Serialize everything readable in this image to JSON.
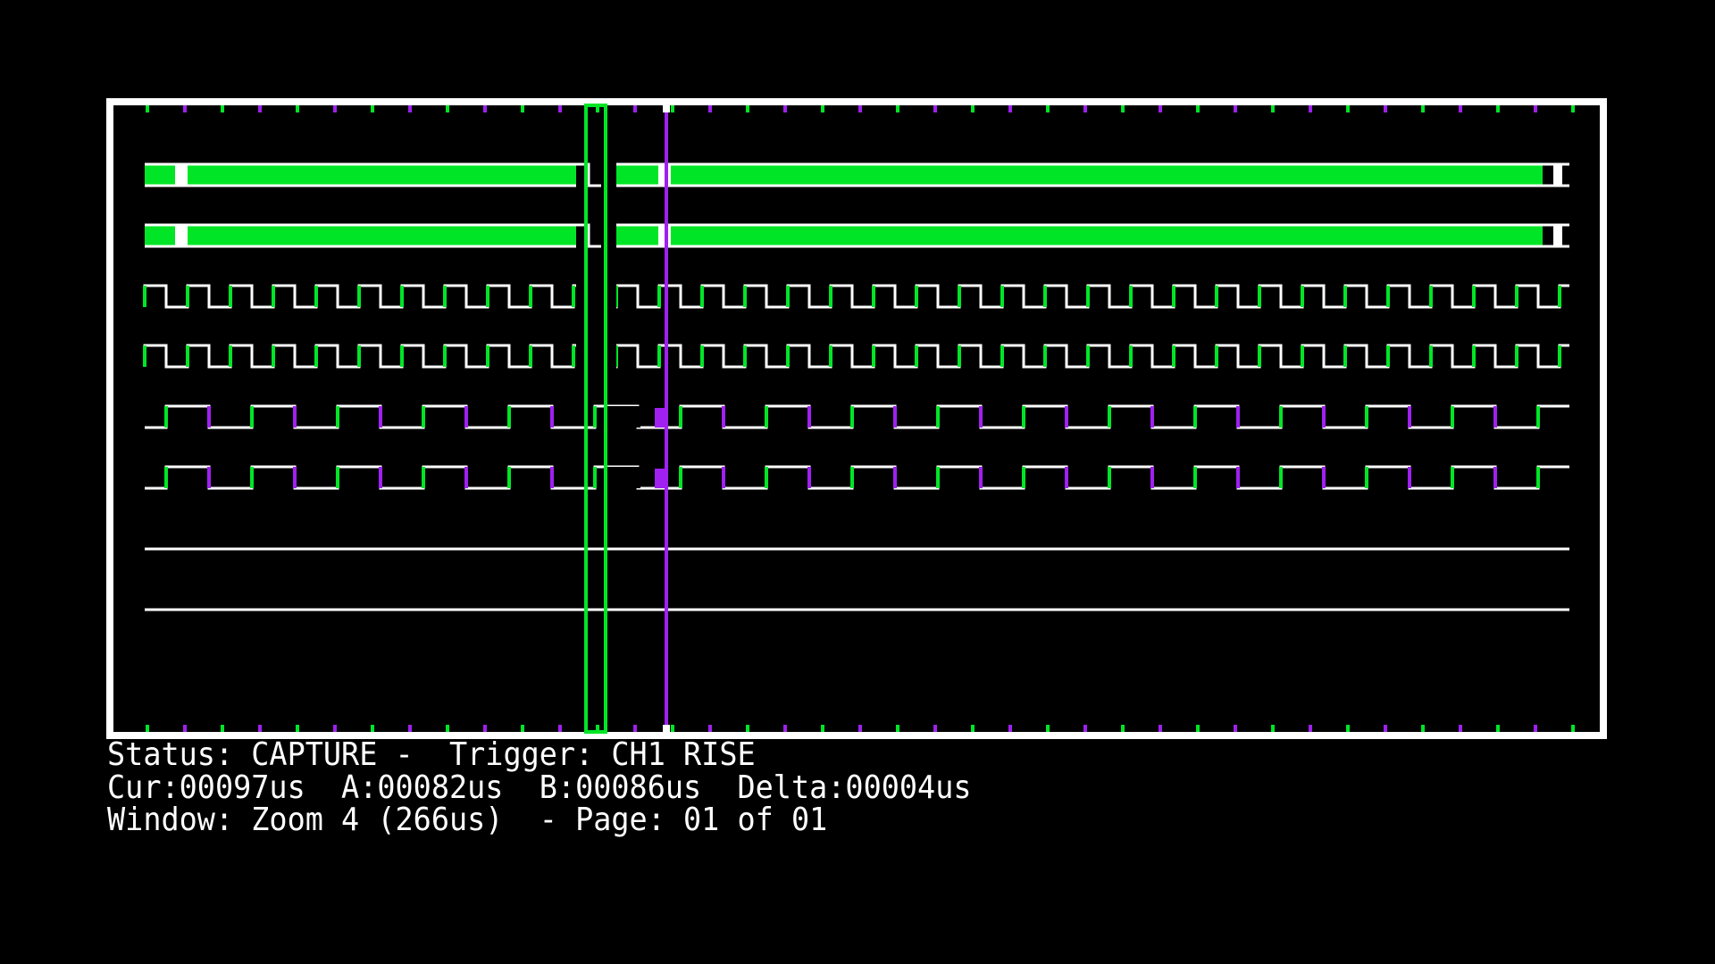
{
  "app": {
    "background_color": "#000000",
    "colors": {
      "trace_white": "#ffffff",
      "trace_green": "#00e626",
      "trace_purple": "#a020f0"
    }
  },
  "scope": {
    "channels": [
      {
        "id": "ch1",
        "kind": "bus"
      },
      {
        "id": "ch2",
        "kind": "bus"
      },
      {
        "id": "ch3",
        "kind": "clock"
      },
      {
        "id": "ch4",
        "kind": "clock"
      },
      {
        "id": "ch5",
        "kind": "slow-clock"
      },
      {
        "id": "ch6",
        "kind": "slow-clock"
      },
      {
        "id": "ch7",
        "kind": "flat"
      },
      {
        "id": "ch8",
        "kind": "flat"
      }
    ],
    "cursors": [
      {
        "name": "A",
        "color": "#00e626"
      },
      {
        "name": "B",
        "color": "#00e626"
      },
      {
        "name": "Cur",
        "color": "#a020f0"
      }
    ]
  },
  "status": {
    "line1": "Status: CAPTURE -  Trigger: CH1 RISE",
    "line2": "Cur:00097us  A:00082us  B:00086us  Delta:00004us",
    "line3": "Window: Zoom 4 (266us)  - Page: 01 of 01"
  }
}
